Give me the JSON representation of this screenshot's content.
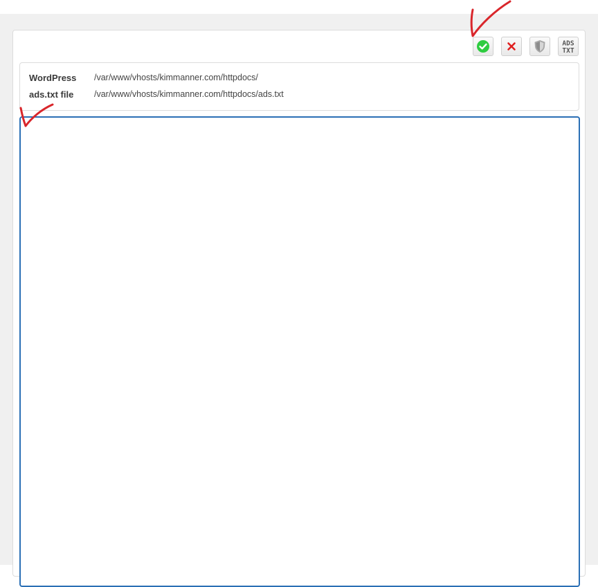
{
  "toolbar": {
    "buttons": [
      {
        "name": "save",
        "icon": "check-circle-icon",
        "color": "#2ecc40"
      },
      {
        "name": "cancel",
        "icon": "close-icon",
        "color": "#e02020"
      },
      {
        "name": "security",
        "icon": "shield-icon",
        "color": "#9a9a9a"
      },
      {
        "name": "ads-txt",
        "icon": "ads-txt-icon",
        "label_line1": "ADS",
        "label_line2": "TXT"
      }
    ]
  },
  "info": {
    "wordpress_label": "WordPress",
    "wordpress_path": "/var/www/vhosts/kimmanner.com/httpdocs/",
    "adstxt_label": "ads.txt file",
    "adstxt_path": "/var/www/vhosts/kimmanner.com/httpdocs/ads.txt"
  },
  "editor": {
    "value": ""
  },
  "colors": {
    "editor_border": "#2a6fb5",
    "annotation": "#d9262b"
  }
}
